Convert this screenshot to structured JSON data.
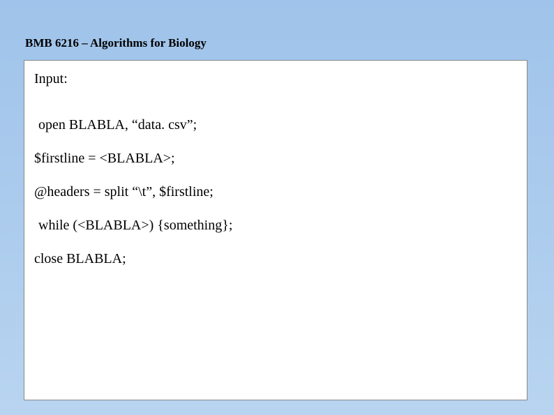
{
  "header": "BMB 6216 – Algorithms for Biology",
  "content": {
    "input_label": "Input:",
    "line1": "open BLABLA, “data. csv”;",
    "line2": "$firstline = <BLABLA>;",
    "line3": "@headers = split “\\t”, $firstline;",
    "line4": "while (<BLABLA>) {something};",
    "line5": "close BLABLA;"
  }
}
